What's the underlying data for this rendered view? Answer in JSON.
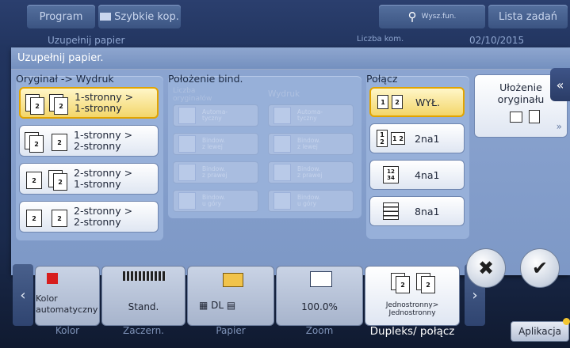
{
  "top": {
    "program": "Program",
    "quick_copy": "Szybkie kop.",
    "search": "Wysz.fun.",
    "jobs": "Lista zadań"
  },
  "subbar": {
    "left": "Uzupełnij papier",
    "middle": "Liczba kom.",
    "date": "02/10/2015"
  },
  "dialog": {
    "title": "Uzupełnij papier.",
    "original_title": "Oryginał -> Wydruk",
    "originals": [
      {
        "label": "1-stronny >\n1-stronny",
        "selected": true
      },
      {
        "label": "1-stronny >\n2-stronny",
        "selected": false
      },
      {
        "label": "2-stronny >\n1-stronny",
        "selected": false
      },
      {
        "label": "2-stronny >\n2-stronny",
        "selected": false
      }
    ],
    "binding_title": "Położenie bind.",
    "binding_orig_label": "Liczba\noryginałów",
    "binding_out_label": "Wydruk",
    "binding_buttons": [
      {
        "label": "Automa-\ntyczny"
      },
      {
        "label": "Bindow.\nz lewej"
      },
      {
        "label": "Bindow.\nz prawej"
      },
      {
        "label": "Bindow.\nu góry"
      }
    ],
    "combine_title": "Połącz",
    "combine": [
      {
        "label": "WYŁ.",
        "selected": true
      },
      {
        "label": "2na1",
        "selected": false
      },
      {
        "label": "4na1",
        "selected": false
      },
      {
        "label": "8na1",
        "selected": false
      }
    ],
    "layout_label": "Ułożenie\noryginału"
  },
  "bottom": {
    "tile_color_text": "Kolor\nautomatyczny",
    "tile_stand": "Stand.",
    "tile_paper": "DL",
    "tile_zoom": "100.0%",
    "tile_duplex": "Jednostronny>\nJednostronny",
    "labels": [
      "Kolor",
      "Zaczern.",
      "Papier",
      "Zoom",
      "Dupleks/ połącz"
    ],
    "app_button": "Aplikacja"
  },
  "colors": {
    "accent": "#e2a400",
    "dialog": "#8ba4d0"
  }
}
